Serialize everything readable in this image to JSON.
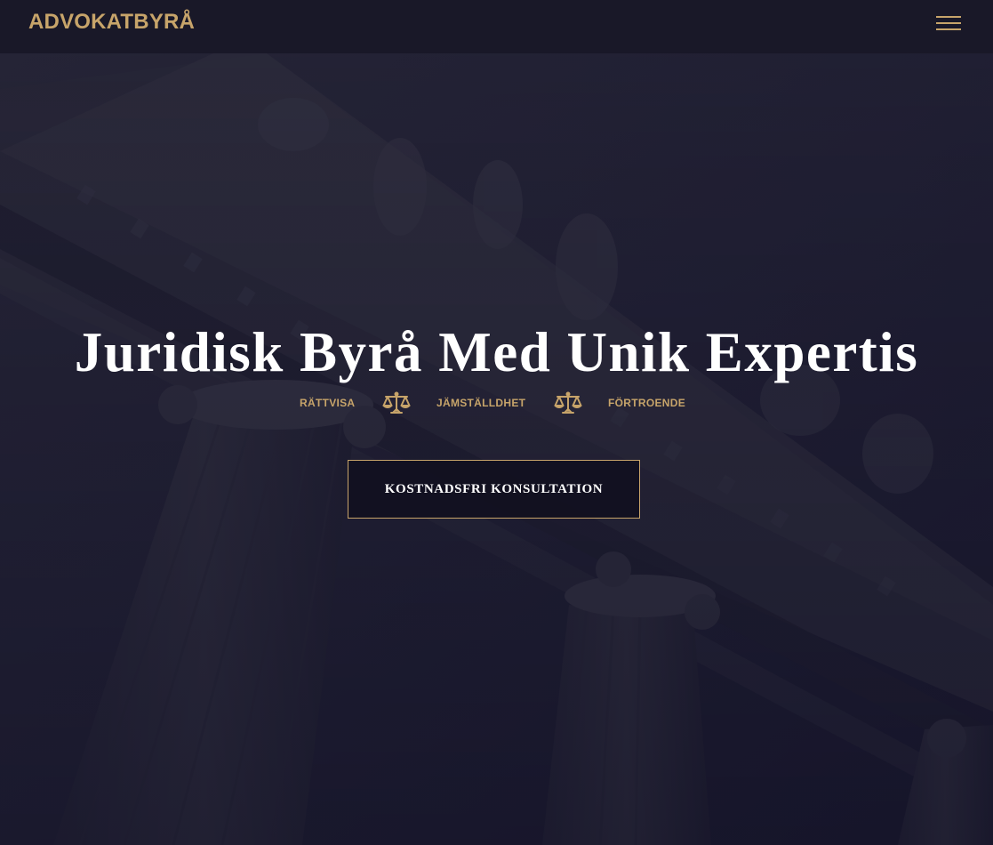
{
  "header": {
    "logo_text": "ADVOKATBYRÅ",
    "menu_icon": "hamburger-menu-icon"
  },
  "hero": {
    "title": "Juridisk Byrå Med Unik Expertis",
    "values": [
      "RÄTTVISA",
      "JÄMSTÄLLDHET",
      "FÖRTROENDE"
    ],
    "separator_icon": "scales-of-justice-icon",
    "cta_label": "KOSTNADSFRI KONSULTATION",
    "background_image": "courthouse-columns-photo"
  },
  "colors": {
    "accent_gold": "#c7a46a",
    "header_bg": "#191828",
    "hero_overlay": "#1d1c30",
    "title_text": "#ffffff"
  }
}
